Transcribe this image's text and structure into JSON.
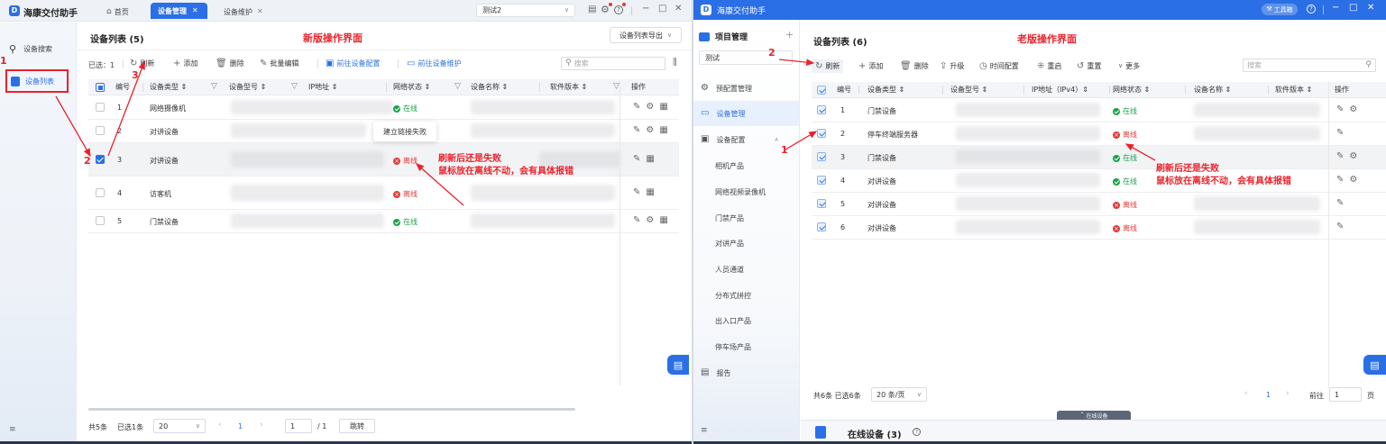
{
  "left": {
    "app_title": "海康交付助手",
    "tabs": [
      {
        "label": "首页"
      },
      {
        "label": "设备管理"
      },
      {
        "label": "设备维护"
      }
    ],
    "workspace": "测试2",
    "sidebar": [
      {
        "label": "设备搜索"
      },
      {
        "label": "设备列表"
      }
    ],
    "list_title": "设备列表 (5)",
    "banner": "新版操作界面",
    "export_label": "设备列表导出",
    "selected_label": "已选：1",
    "toolbar": {
      "refresh": "刷新",
      "add": "添加",
      "delete": "删除",
      "batch_edit": "批量编辑",
      "goto_config": "前往设备配置",
      "goto_maint": "前往设备维护",
      "search_placeholder": "搜索"
    },
    "columns": [
      "编号",
      "设备类型 ⇕",
      "设备型号 ⇕",
      "IP地址 ⇕",
      "网络状态 ⇕",
      "设备名称 ⇕",
      "软件版本 ⇕",
      "操作"
    ],
    "rows": [
      {
        "num": "1",
        "type": "网络摄像机",
        "status": "在线",
        "state": "online",
        "checked": false
      },
      {
        "num": "2",
        "type": "对讲设备",
        "status": "",
        "state": "none",
        "checked": false
      },
      {
        "num": "3",
        "type": "对讲设备",
        "status": "离线",
        "state": "offline",
        "checked": true
      },
      {
        "num": "4",
        "type": "访客机",
        "status": "离线",
        "state": "offline",
        "checked": false
      },
      {
        "num": "5",
        "type": "门禁设备",
        "status": "在线",
        "state": "online",
        "checked": false
      }
    ],
    "tooltip": "建立链接失败",
    "note1": "刷新后还是失败",
    "note2": "鼠标放在离线不动，会有具体报错",
    "footer": {
      "total": "共5条",
      "selected": "已选1条",
      "page_size": "20",
      "page": "1",
      "page_input": "1",
      "page_total": "/ 1",
      "jump": "跳转"
    },
    "step_labels": {
      "s1": "1",
      "s2": "2",
      "s3": "3"
    }
  },
  "right": {
    "app_title": "海康交付助手",
    "toolbox": "工具箱",
    "project_label": "项目管理",
    "project_value": "测试",
    "sidebar": [
      {
        "label": "预配置管理"
      },
      {
        "label": "设备管理"
      },
      {
        "label": "设备配置"
      },
      {
        "label": "相机产品"
      },
      {
        "label": "网络视频录像机"
      },
      {
        "label": "门禁产品"
      },
      {
        "label": "对讲产品"
      },
      {
        "label": "人员通道"
      },
      {
        "label": "分布式拼控"
      },
      {
        "label": "出入口产品"
      },
      {
        "label": "停车场产品"
      },
      {
        "label": "报告"
      }
    ],
    "list_title": "设备列表 (6)",
    "banner": "老版操作界面",
    "toolbar": {
      "refresh": "刷新",
      "add": "添加",
      "delete": "删除",
      "upgrade": "升级",
      "time": "时间配置",
      "reboot": "重启",
      "reset": "重置",
      "more": "更多",
      "search_placeholder": "搜索"
    },
    "columns": [
      "编号",
      "设备类型 ⇕",
      "设备型号 ⇕",
      "IP地址（IPv4）⇕",
      "网络状态 ⇕",
      "设备名称 ⇕",
      "软件版本 ⇕",
      "操作"
    ],
    "rows": [
      {
        "num": "1",
        "type": "门禁设备",
        "status": "在线",
        "state": "online"
      },
      {
        "num": "2",
        "type": "停车终端服务器",
        "status": "离线",
        "state": "offline"
      },
      {
        "num": "3",
        "type": "门禁设备",
        "status": "在线",
        "state": "online"
      },
      {
        "num": "4",
        "type": "对讲设备",
        "status": "在线",
        "state": "online"
      },
      {
        "num": "5",
        "type": "对讲设备",
        "status": "离线",
        "state": "offline"
      },
      {
        "num": "6",
        "type": "对讲设备",
        "status": "离线",
        "state": "offline"
      }
    ],
    "note1": "刷新后还是失败",
    "note2": "鼠标放在离线不动，会有具体报错",
    "footer": {
      "summary": "共6条 已选6条",
      "page_size": "20 条/页",
      "page": "1",
      "goto": "前往",
      "page_input": "1",
      "page_unit": "页"
    },
    "online_devices": "在线设备 (3)",
    "online_tab": "在线设备",
    "step_labels": {
      "s1": "1",
      "s2": "2"
    }
  },
  "colors": {
    "accent": "#2b6fe6",
    "online": "#1aa34a",
    "offline": "#e23a3a",
    "annotation": "#e8232b"
  }
}
